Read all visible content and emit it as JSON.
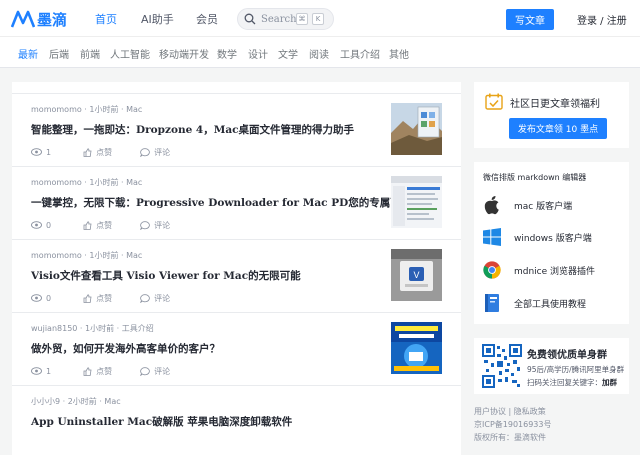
{
  "header": {
    "logo_text": "墨滴",
    "nav": [
      "首页",
      "AI助手",
      "会员"
    ],
    "search_placeholder": "Search",
    "search_keys": [
      "⌘",
      "K"
    ],
    "write_button": "写文章",
    "login": "登录 / 注册"
  },
  "tabs": [
    "最新",
    "后端",
    "前端",
    "人工智能",
    "移动端开发",
    "数学",
    "设计",
    "文学",
    "阅读",
    "工具介绍",
    "其他"
  ],
  "articles": [
    {
      "meta": "momomomo · 1小时前 · Mac",
      "title": "智能整理，一拖即达：Dropzone 4，Mac桌面文件管理的得力助手",
      "views": "1",
      "like": "点赞",
      "comment": "评论",
      "thumb": "mountain"
    },
    {
      "meta": "momomomo · 1小时前 · Mac",
      "title": "一键掌控，无限下载：Progressive Downloader for Mac PD您的专属下载器",
      "views": "0",
      "like": "点赞",
      "comment": "评论",
      "thumb": "app"
    },
    {
      "meta": "momomomo · 1小时前 · Mac",
      "title": "Visio文件查看工具 Visio Viewer for Mac的无限可能",
      "views": "0",
      "like": "点赞",
      "comment": "评论",
      "thumb": "window"
    },
    {
      "meta": "wujian8150 · 1小时前 · 工具介绍",
      "title": "做外贸，如何开发海外高客单价的客户？",
      "views": "1",
      "like": "点赞",
      "comment": "评论",
      "thumb": "promo"
    },
    {
      "meta": "小小小9 · 2小时前 · Mac",
      "title": "App Uninstaller Mac破解版 苹果电脑深度卸载软件",
      "views": "",
      "like": "",
      "comment": "",
      "thumb": ""
    }
  ],
  "sidebar": {
    "sign_title": "社区日更文章领福利",
    "sign_button": "发布文章领 10 墨点",
    "tools_head": "微信排版 markdown 编辑器",
    "tools": [
      "mac 版客户端",
      "windows 版客户端",
      "mdnice 浏览器插件",
      "全部工具使用教程"
    ],
    "qr_title": "免费领优质单身群",
    "qr_line1": "95后/高学历/腾讯阿里单身群",
    "qr_line2": "扫码关注回复关键字：",
    "qr_keyword": "加群",
    "footer": [
      "用户协议 | 隐私政策",
      "京ICP备19016933号",
      "版权所有：墨滴软件"
    ]
  },
  "colors": {
    "accent": "#1e80ff",
    "text": "#252933",
    "muted": "#8a919f"
  }
}
